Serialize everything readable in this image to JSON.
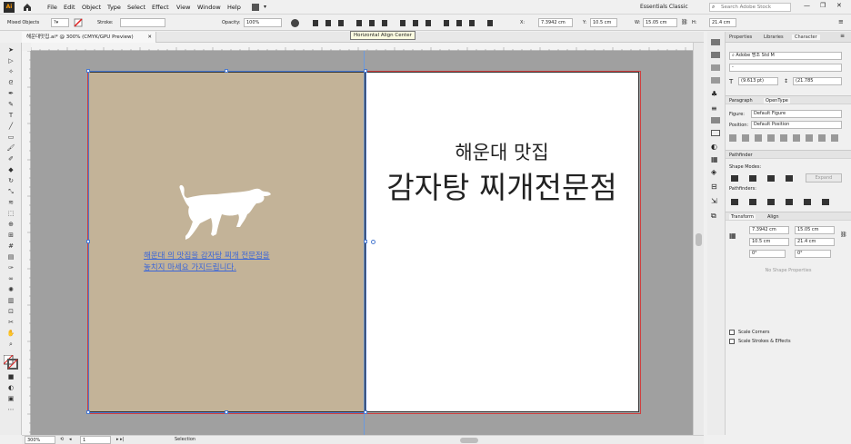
{
  "menubar": {
    "menus": [
      "File",
      "Edit",
      "Object",
      "Type",
      "Select",
      "Effect",
      "View",
      "Window",
      "Help"
    ],
    "workspace": "Essentials Classic",
    "search_placeholder": "Search Adobe Stock"
  },
  "control": {
    "selection_label": "Mixed Objects",
    "stroke_label": "Stroke:",
    "opacity_label": "Opacity:",
    "opacity_value": "100%",
    "x_label": "X:",
    "x_value": "7.3942 cm",
    "y_label": "Y:",
    "y_value": "10.5 cm",
    "w_label": "W:",
    "w_value": "15.05 cm",
    "h_label": "H:",
    "h_value": "21.4 cm",
    "tooltip": "Horizontal Align Center"
  },
  "document": {
    "tab_title": "해운대맛집.ai* @ 300% (CMYK/GPU Preview)",
    "title_small": "해운대 맛집",
    "title_large": "감자탕 찌개전문점",
    "body_line1": "해운대 의 맛집을 감자탕 찌개 전문점을",
    "body_line2": "놓치지 마세요 가지드립니다.",
    "colors": {
      "left_page": "#c3b398",
      "right_page": "#ffffff",
      "artboard_border": "#d04040",
      "selection": "#4a7ad0"
    }
  },
  "status": {
    "zoom": "300%",
    "artboard": "1",
    "tool": "Selection"
  },
  "panel": {
    "tabs": [
      "Properties",
      "Libraries",
      "Character"
    ],
    "font_family": "Adobe 명조 Std M",
    "font_size": "(9.613 pt)",
    "tracking": "(21.785",
    "paragraph_tab": "Paragraph",
    "opentype_tab": "OpenType",
    "figure_label": "Figure:",
    "figure_value": "Default Figure",
    "position_label": "Position:",
    "position_value": "Default Position",
    "pathfinder_title": "Pathfinder",
    "shape_modes": "Shape Modes:",
    "expand": "Expand",
    "pathfinders": "Pathfinders:",
    "transform_tab": "Transform",
    "align_tab": "Align",
    "t_x": "7.3942 cm",
    "t_y": "10.5 cm",
    "t_w": "15.05 cm",
    "t_h": "21.4 cm",
    "angle1": "0°",
    "angle2": "0°",
    "no_shape": "No Shape Properties",
    "scale_corners": "Scale Corners",
    "scale_strokes": "Scale Strokes & Effects"
  }
}
